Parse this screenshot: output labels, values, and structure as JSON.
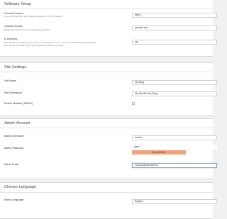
{
  "software_setup": {
    "title": "Software Setup",
    "protocol_label": "Choose Protocol",
    "protocol_hint": "If your site has SSL, then please choose the HTTPS protocol.",
    "protocol_value": "http://",
    "domain_label": "Choose Domain",
    "domain_hint": "Please choose the domain to install the software.",
    "domain_value": "qureshi.me",
    "directory_label": "In Directory",
    "directory_hint_line1": "The directory is relative to your domain and should not exist. e.g. To install at http://mydomain/dir/",
    "directory_hint_line2": "just type dir. To install only in http://mydomain/ leave this empty.",
    "directory_value": "wp"
  },
  "site_settings": {
    "title": "Site Settings",
    "site_name_label": "Site Name",
    "site_name_value": "My Blog",
    "site_desc_label": "Site Description",
    "site_desc_value": "My WordPress Blog",
    "multisite_label": "Enable Multisite (WPMU)"
  },
  "admin_account": {
    "title": "Admin Account",
    "username_label": "Admin Username",
    "username_value": "admin",
    "password_label": "Admin Password",
    "password_value": "pass",
    "strength_text": "Bad (19/100)",
    "email_label": "Admin Email",
    "email_value": "1q1q1q@qureshi.me"
  },
  "language": {
    "title": "Choose Language",
    "select_label": "Select Language",
    "select_value": "English"
  },
  "colors": {
    "strength_bar": "#f4a27a",
    "focus_border": "#7aa7d6"
  }
}
